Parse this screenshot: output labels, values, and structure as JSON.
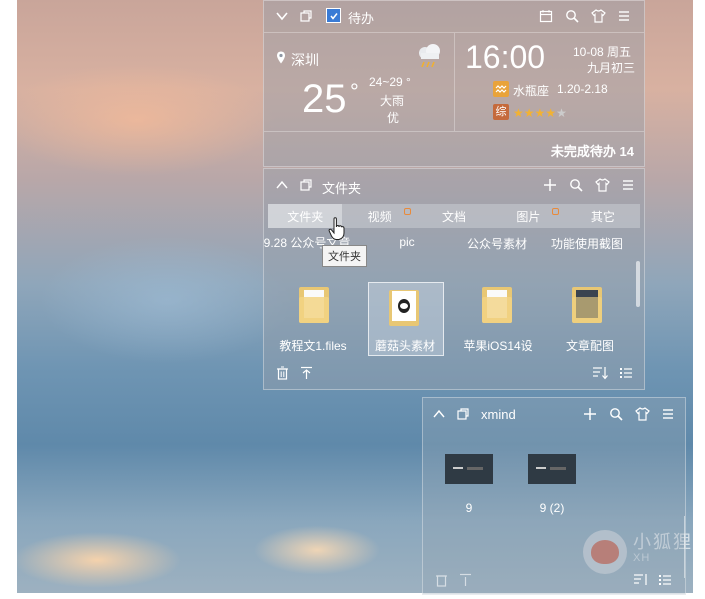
{
  "todo_panel": {
    "title": "待办",
    "weather": {
      "city": "深圳",
      "temp": "25",
      "unit": "°",
      "range": "24~29 °",
      "condition": "大雨",
      "air": "优"
    },
    "clock": {
      "time": "16:00",
      "date": "10-08 周五",
      "lunar": "九月初三",
      "zodiac": "水瓶座",
      "zodiac_dates": "1.20-2.18",
      "rating": 4,
      "rating_max": 5
    },
    "pending_label": "未完成待办",
    "pending_count": "14"
  },
  "file_panel": {
    "title": "文件夹",
    "tabs": [
      {
        "label": "文件夹",
        "active": true,
        "dot": false
      },
      {
        "label": "视频",
        "active": false,
        "dot": true
      },
      {
        "label": "文档",
        "active": false,
        "dot": false
      },
      {
        "label": "图片",
        "active": false,
        "dot": true
      },
      {
        "label": "其它",
        "active": false,
        "dot": false
      }
    ],
    "tooltip": "文件夹",
    "row1": [
      "9.28 公众号文章",
      "pic",
      "公众号素材",
      "功能使用截图"
    ],
    "row2": [
      "教程文1.files",
      "蘑菇头素材",
      "苹果iOS14设",
      "文章配图"
    ]
  },
  "xmind_panel": {
    "title": "xmind",
    "files": [
      "9",
      "9 (2)"
    ]
  },
  "watermark": {
    "text": "小狐狸网",
    "sub": "XH"
  },
  "colors": {
    "accent_orange": "#e98a3a",
    "star": "#f2b233",
    "checkbox": "#3a7bd5"
  }
}
